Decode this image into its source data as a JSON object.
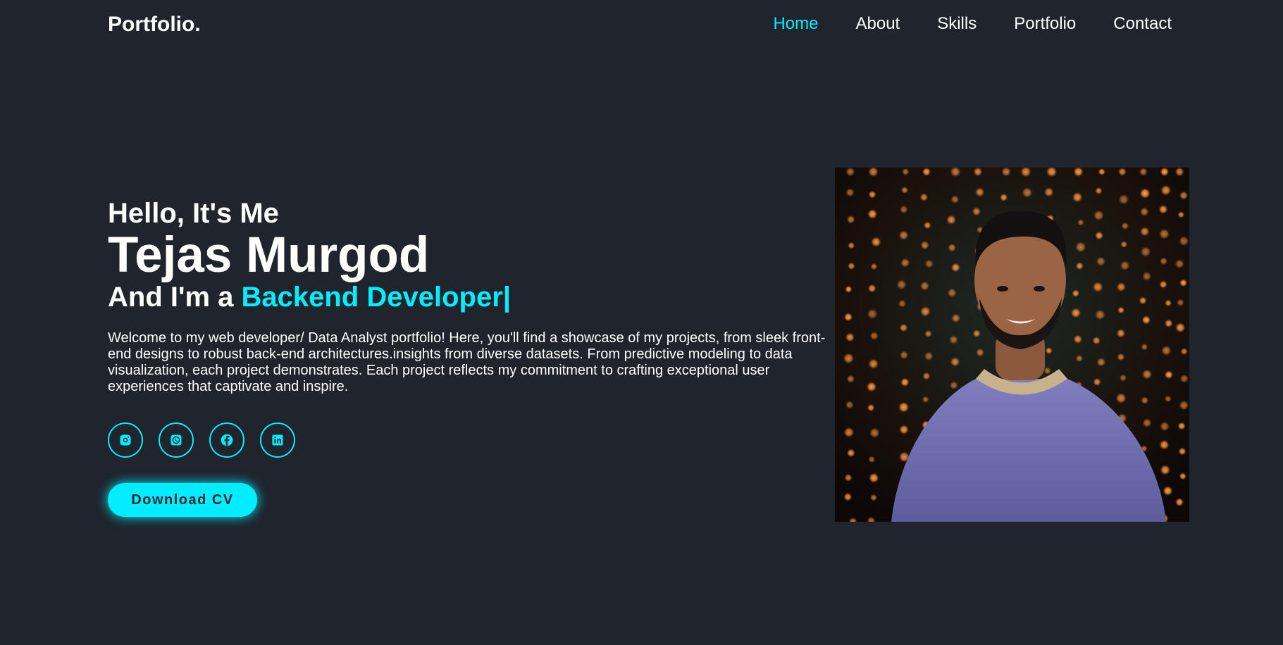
{
  "header": {
    "logo": "Portfolio.",
    "nav": [
      "Home",
      "About",
      "Skills",
      "Portfolio",
      "Contact"
    ]
  },
  "hero": {
    "greeting": "Hello, It's Me",
    "name": "Tejas Murgod",
    "role_prefix": "And I'm a ",
    "role_highlight": "Backend Developer",
    "cursor": "|",
    "intro": "Welcome to my web developer/ Data Analyst portfolio! Here, you'll find a showcase of my projects, from sleek front-end designs to robust back-end architectures.insights from diverse datasets. From predictive modeling to data visualization, each project demonstrates. Each project reflects my commitment to crafting exceptional user experiences that captivate and inspire.",
    "socials": [
      "instagram-icon",
      "whatsapp-icon",
      "facebook-icon",
      "linkedin-icon"
    ],
    "cv_button": "Download CV"
  },
  "colors": {
    "background": "#1f242d",
    "accent": "#00eeff",
    "text": "#ffffff"
  }
}
